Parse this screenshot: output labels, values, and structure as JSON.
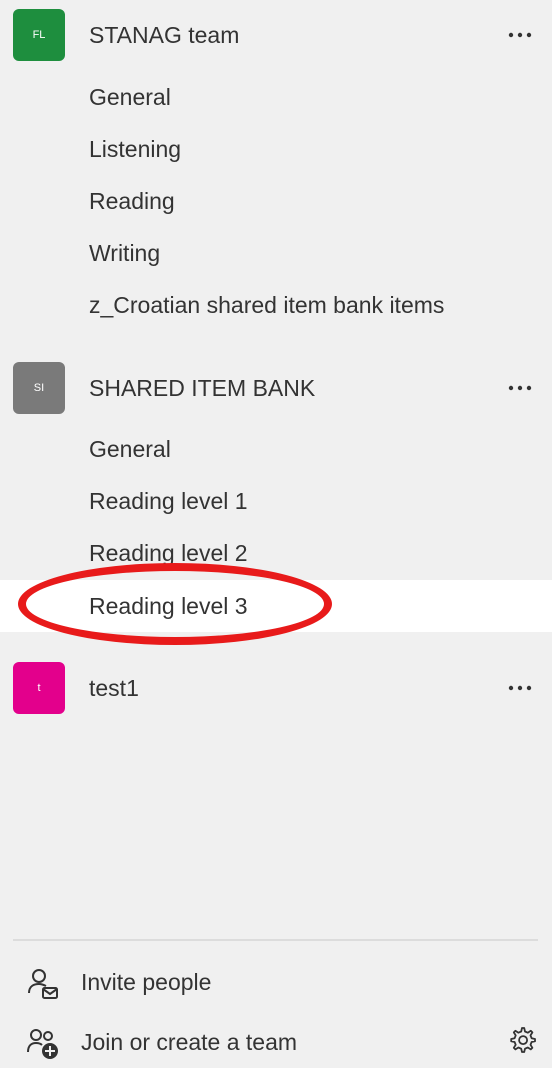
{
  "teams": [
    {
      "initials": "FL",
      "name": "STANAG team",
      "color": "#1e8e3e",
      "channels": [
        "General",
        "Listening",
        "Reading",
        "Writing",
        "z_Croatian shared item bank items"
      ]
    },
    {
      "initials": "SI",
      "name": "SHARED ITEM BANK",
      "color": "#7a7a7a",
      "channels": [
        "General",
        "Reading level 1",
        "Reading level 2",
        "Reading level 3"
      ]
    },
    {
      "initials": "t",
      "name": "test1",
      "color": "#e3008c",
      "channels": []
    }
  ],
  "more_label": "···",
  "footer": {
    "invite_label": "Invite people",
    "join_label": "Join or create a team"
  },
  "highlight_color": "#e81a1a"
}
